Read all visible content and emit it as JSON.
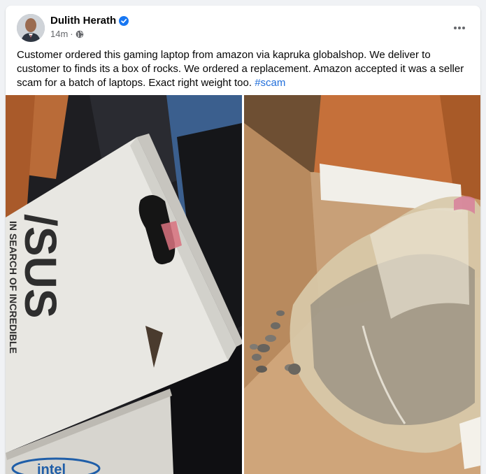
{
  "post": {
    "author": "Dulith Herath",
    "timestamp": "14m",
    "separator": "·",
    "verified_icon": "verified-badge-icon",
    "privacy_icon": "globe-icon",
    "more_icon": "more-options-icon",
    "body_text": "Customer ordered this gaming laptop from amazon via kapruka globalshop. We deliver to customer to finds its a box of rocks. We ordered a replacement. Amazon accepted it was a seller scam for a batch of laptops. Exact right weight too.",
    "hashtag": "#scam"
  },
  "photos": {
    "left": {
      "brand_text": "/SUS",
      "tagline": "IN SEARCH OF INCREDIBLE",
      "footer_logo": "intel"
    }
  },
  "colors": {
    "page_bg": "#f0f2f5",
    "card_bg": "#ffffff",
    "primary_text": "#050505",
    "secondary_text": "#65676b",
    "link": "#216fdb",
    "verified": "#1877f2"
  }
}
